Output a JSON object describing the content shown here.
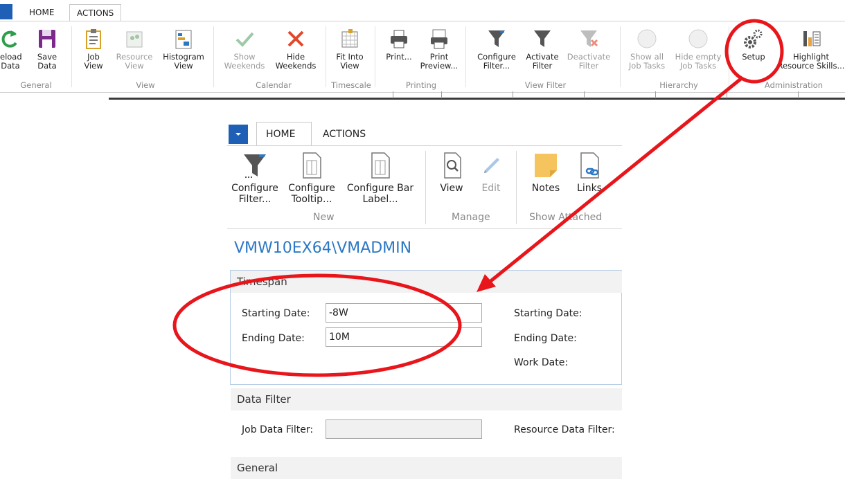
{
  "top": {
    "tabs": [
      "HOME",
      "ACTIONS"
    ],
    "buttons": {
      "reload": "eload\nData",
      "save": "Save\nData",
      "job_view": "Job\nView",
      "resource_view": "Resource\nView",
      "histogram_view": "Histogram\nView",
      "show_weekends": "Show\nWeekends",
      "hide_weekends": "Hide\nWeekends",
      "fit_into_view": "Fit Into\nView",
      "print": "Print...",
      "print_preview": "Print\nPreview...",
      "configure_filter": "Configure\nFilter...",
      "activate_filter": "Activate\nFilter",
      "deactivate_filter": "Deactivate\nFilter",
      "show_all_job_tasks": "Show all\nJob Tasks",
      "hide_empty_job_tasks": "Hide empty\nJob Tasks",
      "setup": "Setup",
      "highlight_resource_skills": "Highlight\nResource Skills..."
    },
    "groups": [
      "General",
      "View",
      "Calendar",
      "Timescale",
      "Printing",
      "View Filter",
      "Hierarchy",
      "Administration"
    ]
  },
  "dialog": {
    "tabs": [
      "HOME",
      "ACTIONS"
    ],
    "buttons": {
      "configure_filter": "Configure\nFilter...",
      "configure_tooltip": "Configure\nTooltip...",
      "configure_bar_label": "Configure Bar\nLabel...",
      "view": "View",
      "edit": "Edit",
      "notes": "Notes",
      "links": "Links"
    },
    "groups": [
      "New",
      "Manage",
      "Show Attached"
    ],
    "title": "VMW10EX64\\VMADMIN",
    "sections": {
      "timespan": {
        "heading": "Timespan",
        "starting_date_label": "Starting Date:",
        "starting_date_value": "-8W",
        "ending_date_label": "Ending Date:",
        "ending_date_value": "10M",
        "right_starting_date_label": "Starting Date:",
        "right_ending_date_label": "Ending Date:",
        "work_date_label": "Work Date:"
      },
      "data_filter": {
        "heading": "Data Filter",
        "job_filter_label": "Job Data Filter:",
        "job_filter_value": "",
        "resource_filter_label": "Resource Data Filter:"
      },
      "general": {
        "heading": "General"
      }
    }
  },
  "colors": {
    "annotation": "#e8151b",
    "brand_blue": "#1f5fb5",
    "title_blue": "#2b78c5"
  }
}
